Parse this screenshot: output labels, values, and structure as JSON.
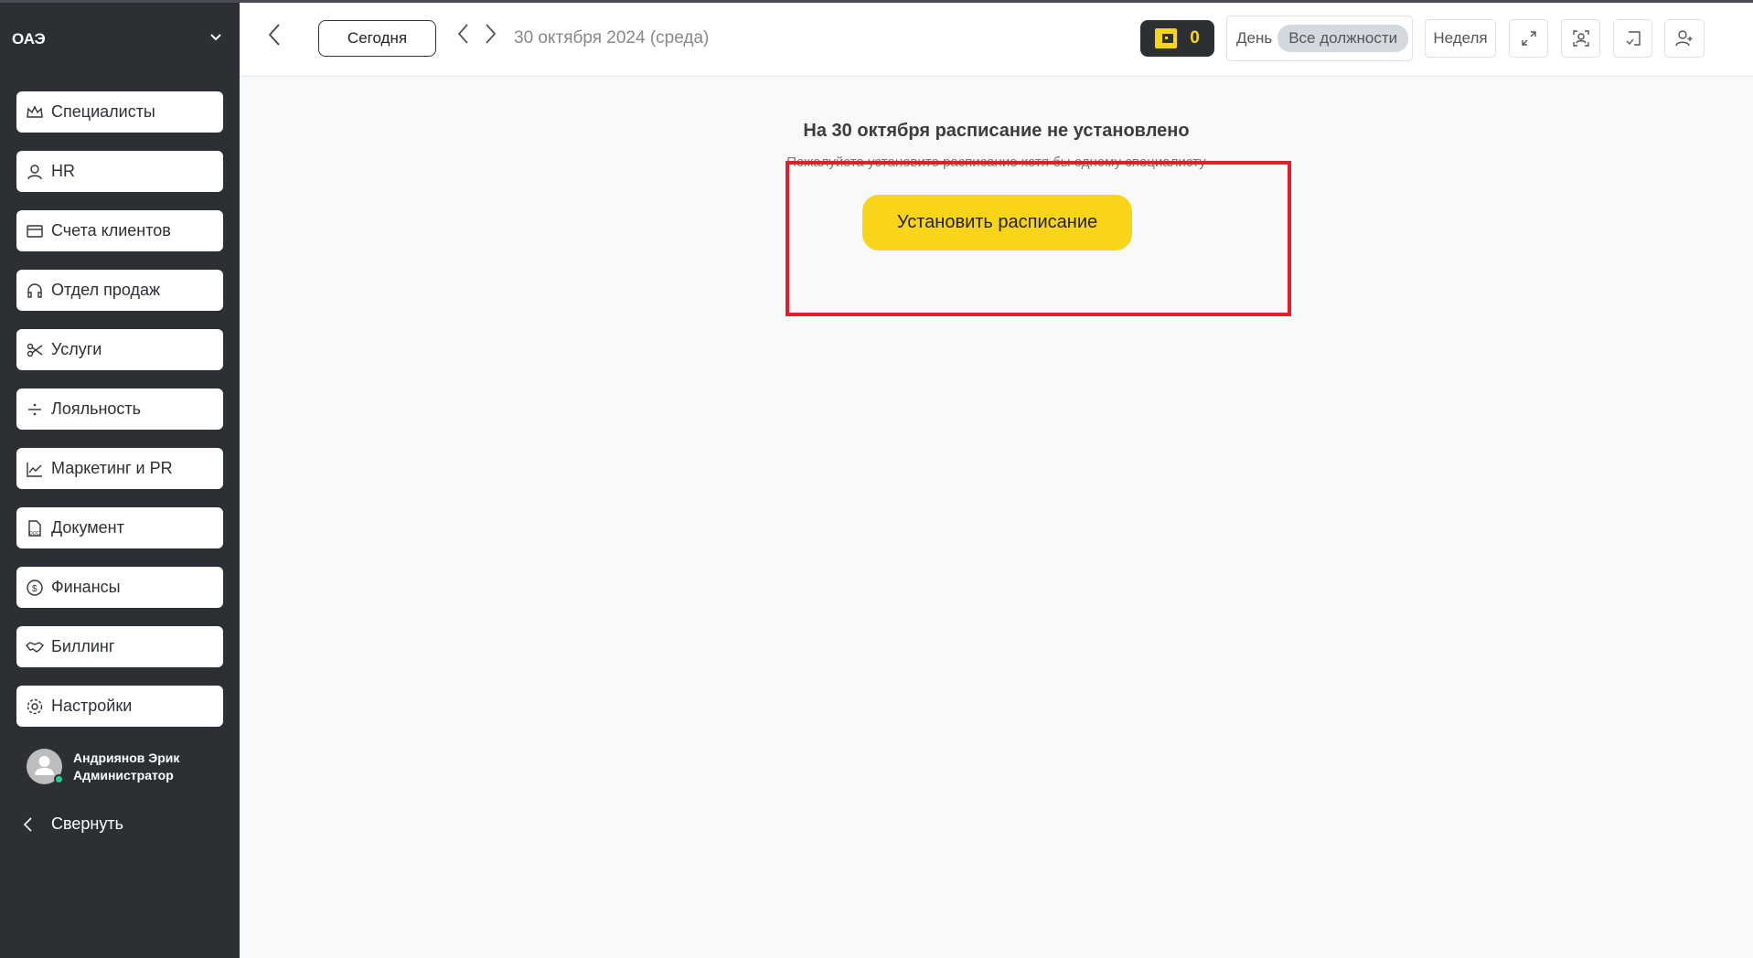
{
  "sidebar": {
    "org": "ОАЭ",
    "items": [
      {
        "label": "Специалисты",
        "icon": "crown-icon"
      },
      {
        "label": "HR",
        "icon": "user-icon"
      },
      {
        "label": "Счета клиентов",
        "icon": "wallet-icon"
      },
      {
        "label": "Отдел продаж",
        "icon": "headset-icon"
      },
      {
        "label": "Услуги",
        "icon": "scissors-icon"
      },
      {
        "label": "Лояльность",
        "icon": "divide-icon"
      },
      {
        "label": "Маркетинг и PR",
        "icon": "chart-icon"
      },
      {
        "label": "Документ",
        "icon": "doc-icon"
      },
      {
        "label": "Финансы",
        "icon": "dollar-icon"
      },
      {
        "label": "Биллинг",
        "icon": "handshake-icon"
      },
      {
        "label": "Настройки",
        "icon": "gear-icon"
      }
    ],
    "user": {
      "name": "Андриянов Эрик",
      "role": "Администратор",
      "status_color": "#1ed190"
    },
    "collapse": "Свернуть"
  },
  "header": {
    "today": "Сегодня",
    "date": "30 октября 2024 (среда)",
    "wallet_count": "0",
    "day": "День",
    "positions": "Все должности",
    "week": "Неделя"
  },
  "main": {
    "title": "На 30 октября расписание не установлено",
    "subtitle": "Пожалуйста установите расписание хотя бы одному специалисту",
    "cta": "Установить расписание"
  },
  "colors": {
    "accent": "#f8d51a",
    "sidebar": "#2c3035",
    "highlight": "#e41e25"
  }
}
